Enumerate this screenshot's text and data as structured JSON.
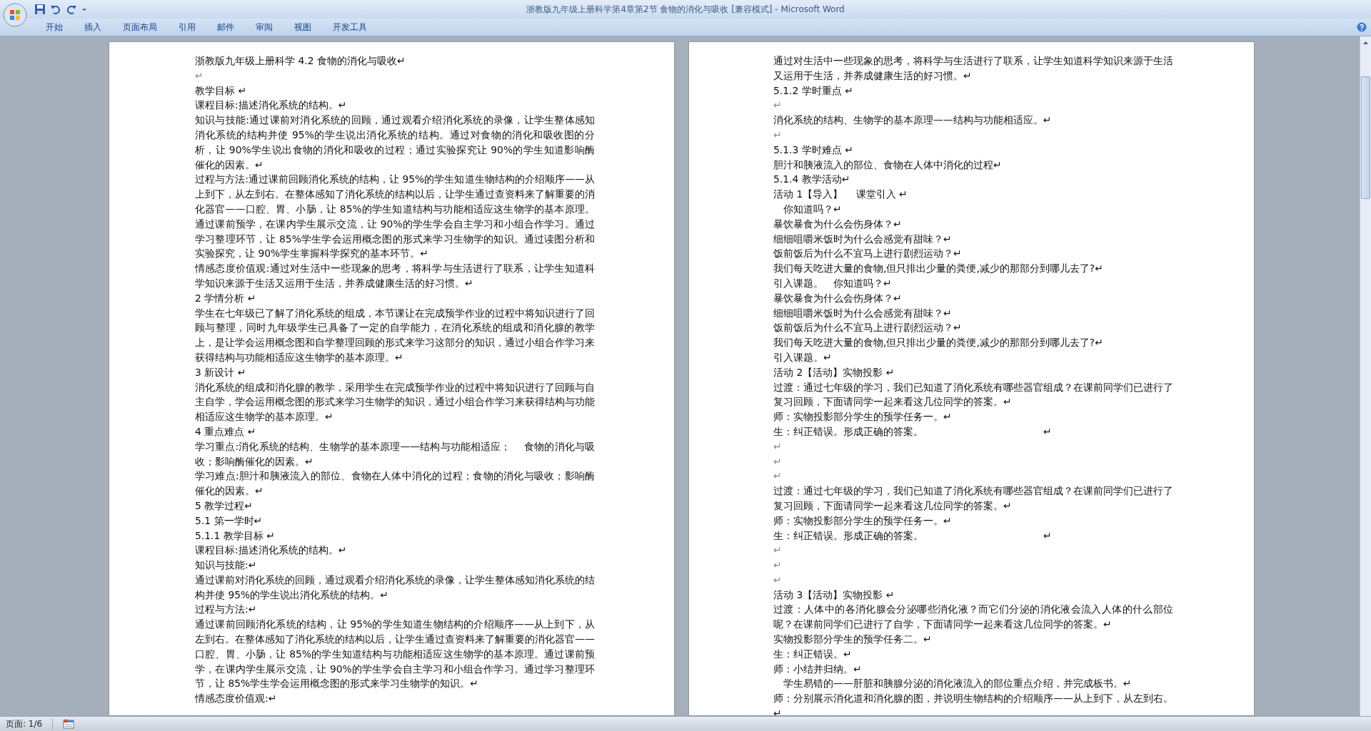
{
  "window": {
    "title": "浙教版九年级上册科学第4章第2节 食物的消化与吸收 [兼容模式] - Microsoft Word"
  },
  "ribbon_tabs": [
    "开始",
    "插入",
    "页面布局",
    "引用",
    "邮件",
    "审阅",
    "视图",
    "开发工具"
  ],
  "pages": [
    {
      "paragraphs": [
        {
          "kind": "text",
          "text": "浙教版九年级上册科学 4.2 食物的消化与吸收↵"
        },
        {
          "kind": "blank",
          "text": "↵"
        },
        {
          "kind": "text",
          "text": "教学目标 ↵"
        },
        {
          "kind": "text",
          "text": "课程目标:描述消化系统的结构。↵"
        },
        {
          "kind": "text",
          "text": "知识与技能:通过课前对消化系统的回顾，通过观看介绍消化系统的录像，让学生整体感知消化系统的结构并使 95%的学生说出消化系统的结构。通过对食物的消化和吸收图的分析，让 90%学生说出食物的消化和吸收的过程；通过实验探究让 90%的学生知道影响酶催化的因素。↵"
        },
        {
          "kind": "text",
          "text": "过程与方法:通过课前回顾消化系统的结构，让 95%的学生知道生物结构的介绍顺序——从上到下，从左到右。在整体感知了消化系统的结构以后，让学生通过查资料来了解重要的消化器官——口腔、胃、小肠，让 85%的学生知道结构与功能相适应这生物学的基本原理。通过课前预学，在课内学生展示交流，让 90%的学生学会自主学习和小组合作学习。通过学习整理环节，让 85%学生学会运用概念图的形式来学习生物学的知识。通过读图分析和实验探究，让 90%学生掌握科学探究的基本环节。↵"
        },
        {
          "kind": "text",
          "text": "情感态度价值观:通过对生活中一些现象的思考，将科学与生活进行了联系，让学生知道科学知识来源于生活又运用于生活，并养成健康生活的好习惯。↵"
        },
        {
          "kind": "text",
          "text": "2 学情分析 ↵"
        },
        {
          "kind": "text",
          "text": "学生在七年级已了解了消化系统的组成，本节课让在完成预学作业的过程中将知识进行了回顾与整理，同时九年级学生已具备了一定的自学能力，在消化系统的组成和消化腺的教学上，是让学会运用概念图和自学整理回顾的形式来学习这部分的知识，通过小组合作学习来获得结构与功能相适应这生物学的基本原理。↵"
        },
        {
          "kind": "text",
          "text": "3 新设计 ↵"
        },
        {
          "kind": "text",
          "text": "消化系统的组成和消化腺的教学，采用学生在完成预学作业的过程中将知识进行了回顾与自主自学，学会运用概念图的形式来学习生物学的知识，通过小组合作学习来获得结构与功能相适应这生物学的基本原理。↵"
        },
        {
          "kind": "text",
          "text": "4 重点难点 ↵"
        },
        {
          "kind": "text",
          "text": "学习重点:消化系统的结构、生物学的基本原理——结构与功能相适应；　 食物的消化与吸收；影响酶催化的因素。↵"
        },
        {
          "kind": "text",
          "text": "学习难点:胆汁和胰液流入的部位、食物在人体中消化的过程；食物的消化与吸收；影响酶催化的因素。↵"
        },
        {
          "kind": "text",
          "text": "5 教学过程↵"
        },
        {
          "kind": "text",
          "text": "5.1 第一学时↵"
        },
        {
          "kind": "text",
          "text": "5.1.1 教学目标 ↵"
        },
        {
          "kind": "text",
          "text": "课程目标:描述消化系统的结构。↵"
        },
        {
          "kind": "text",
          "text": "知识与技能:↵"
        },
        {
          "kind": "text",
          "text": "通过课前对消化系统的回顾，通过观看介绍消化系统的录像，让学生整体感知消化系统的结构并使 95%的学生说出消化系统的结构。↵"
        },
        {
          "kind": "text",
          "text": "过程与方法:↵"
        },
        {
          "kind": "text",
          "text": "通过课前回顾消化系统的结构，让 95%的学生知道生物结构的介绍顺序——从上到下，从左到右。在整体感知了消化系统的结构以后，让学生通过查资料来了解重要的消化器官——口腔、胃、小肠，让 85%的学生知道结构与功能相适应这生物学的基本原理。通过课前预学，在课内学生展示交流，让 90%的学生学会自主学习和小组合作学习。通过学习整理环节，让 85%学生学会运用概念图的形式来学习生物学的知识。↵"
        },
        {
          "kind": "text",
          "text": "情感态度价值观:↵"
        }
      ]
    },
    {
      "paragraphs": [
        {
          "kind": "text",
          "text": "通过对生活中一些现象的思考，将科学与生活进行了联系，让学生知道科学知识来源于生活又运用于生活，并养成健康生活的好习惯。↵"
        },
        {
          "kind": "text",
          "text": "5.1.2 学时重点 ↵"
        },
        {
          "kind": "blank",
          "text": "↵"
        },
        {
          "kind": "text",
          "text": "消化系统的结构、生物学的基本原理——结构与功能相适应。↵"
        },
        {
          "kind": "blank",
          "text": "↵"
        },
        {
          "kind": "text",
          "text": "5.1.3 学时难点 ↵"
        },
        {
          "kind": "text",
          "text": "胆汁和胰液流入的部位、食物在人体中消化的过程↵"
        },
        {
          "kind": "text",
          "text": "5.1.4 教学活动↵"
        },
        {
          "kind": "text",
          "text": "活动 1【导入】　 课堂引入 ↵"
        },
        {
          "kind": "text",
          "text": "　你知道吗？↵"
        },
        {
          "kind": "text",
          "text": "暴饮暴食为什么会伤身体？↵"
        },
        {
          "kind": "text",
          "text": "细细咀嚼米饭时为什么会感觉有甜味？↵"
        },
        {
          "kind": "text",
          "text": "饭前饭后为什么不宜马上进行剧烈运动？↵"
        },
        {
          "kind": "text",
          "text": "我们每天吃进大量的食物,但只排出少量的粪便,减少的那部分到哪儿去了?↵"
        },
        {
          "kind": "text",
          "text": "引入课题。　你知道吗？↵"
        },
        {
          "kind": "text",
          "text": "暴饮暴食为什么会伤身体？↵"
        },
        {
          "kind": "text",
          "text": "细细咀嚼米饭时为什么会感觉有甜味？↵"
        },
        {
          "kind": "text",
          "text": "饭前饭后为什么不宜马上进行剧烈运动？↵"
        },
        {
          "kind": "text",
          "text": "我们每天吃进大量的食物,但只排出少量的粪便,减少的那部分到哪儿去了?↵"
        },
        {
          "kind": "text",
          "text": "引入课题。↵"
        },
        {
          "kind": "text",
          "text": "活动 2【活动】实物投影 ↵"
        },
        {
          "kind": "text",
          "text": "过渡：通过七年级的学习，我们已知道了消化系统有哪些器官组成？在课前同学们已进行了复习回顾，下面请同学一起来看这几位同学的答案。↵"
        },
        {
          "kind": "text",
          "text": "师：实物投影部分学生的预学任务一。↵"
        },
        {
          "kind": "text",
          "text": "生：纠正错误。形成正确的答案。　　　　　　　　　　　　↵"
        },
        {
          "kind": "blank",
          "text": "↵"
        },
        {
          "kind": "blank",
          "text": "↵"
        },
        {
          "kind": "blank",
          "text": "↵"
        },
        {
          "kind": "text",
          "text": "过渡：通过七年级的学习，我们已知道了消化系统有哪些器官组成？在课前同学们已进行了复习回顾，下面请同学一起来看这几位同学的答案。↵"
        },
        {
          "kind": "text",
          "text": "师：实物投影部分学生的预学任务一。↵"
        },
        {
          "kind": "text",
          "text": "生：纠正错误。形成正确的答案。　　　　　　　　　　　　↵"
        },
        {
          "kind": "blank",
          "text": "↵"
        },
        {
          "kind": "blank",
          "text": "↵"
        },
        {
          "kind": "blank",
          "text": "↵"
        },
        {
          "kind": "text",
          "text": "活动 3【活动】实物投影 ↵"
        },
        {
          "kind": "text",
          "text": "过渡：人体中的各消化腺会分泌哪些消化液？而它们分泌的消化液会流入人体的什么部位呢？在课前同学们已进行了自学，下面请同学一起来看这几位同学的答案。↵"
        },
        {
          "kind": "text",
          "text": "实物投影部分学生的预学任务二。↵"
        },
        {
          "kind": "text",
          "text": "生：纠正错误。↵"
        },
        {
          "kind": "text",
          "text": "师：小结并归纳。↵"
        },
        {
          "kind": "text",
          "text": "　学生易错的——肝脏和胰腺分泌的消化液流入的部位重点介绍，并完成板书。↵"
        },
        {
          "kind": "text",
          "text": "师：分别展示消化道和消化腺的图，并说明生物结构的介绍顺序——从上到下，从左到右。↵"
        }
      ]
    }
  ],
  "status_bar": {
    "page": "页面: 1/6"
  }
}
